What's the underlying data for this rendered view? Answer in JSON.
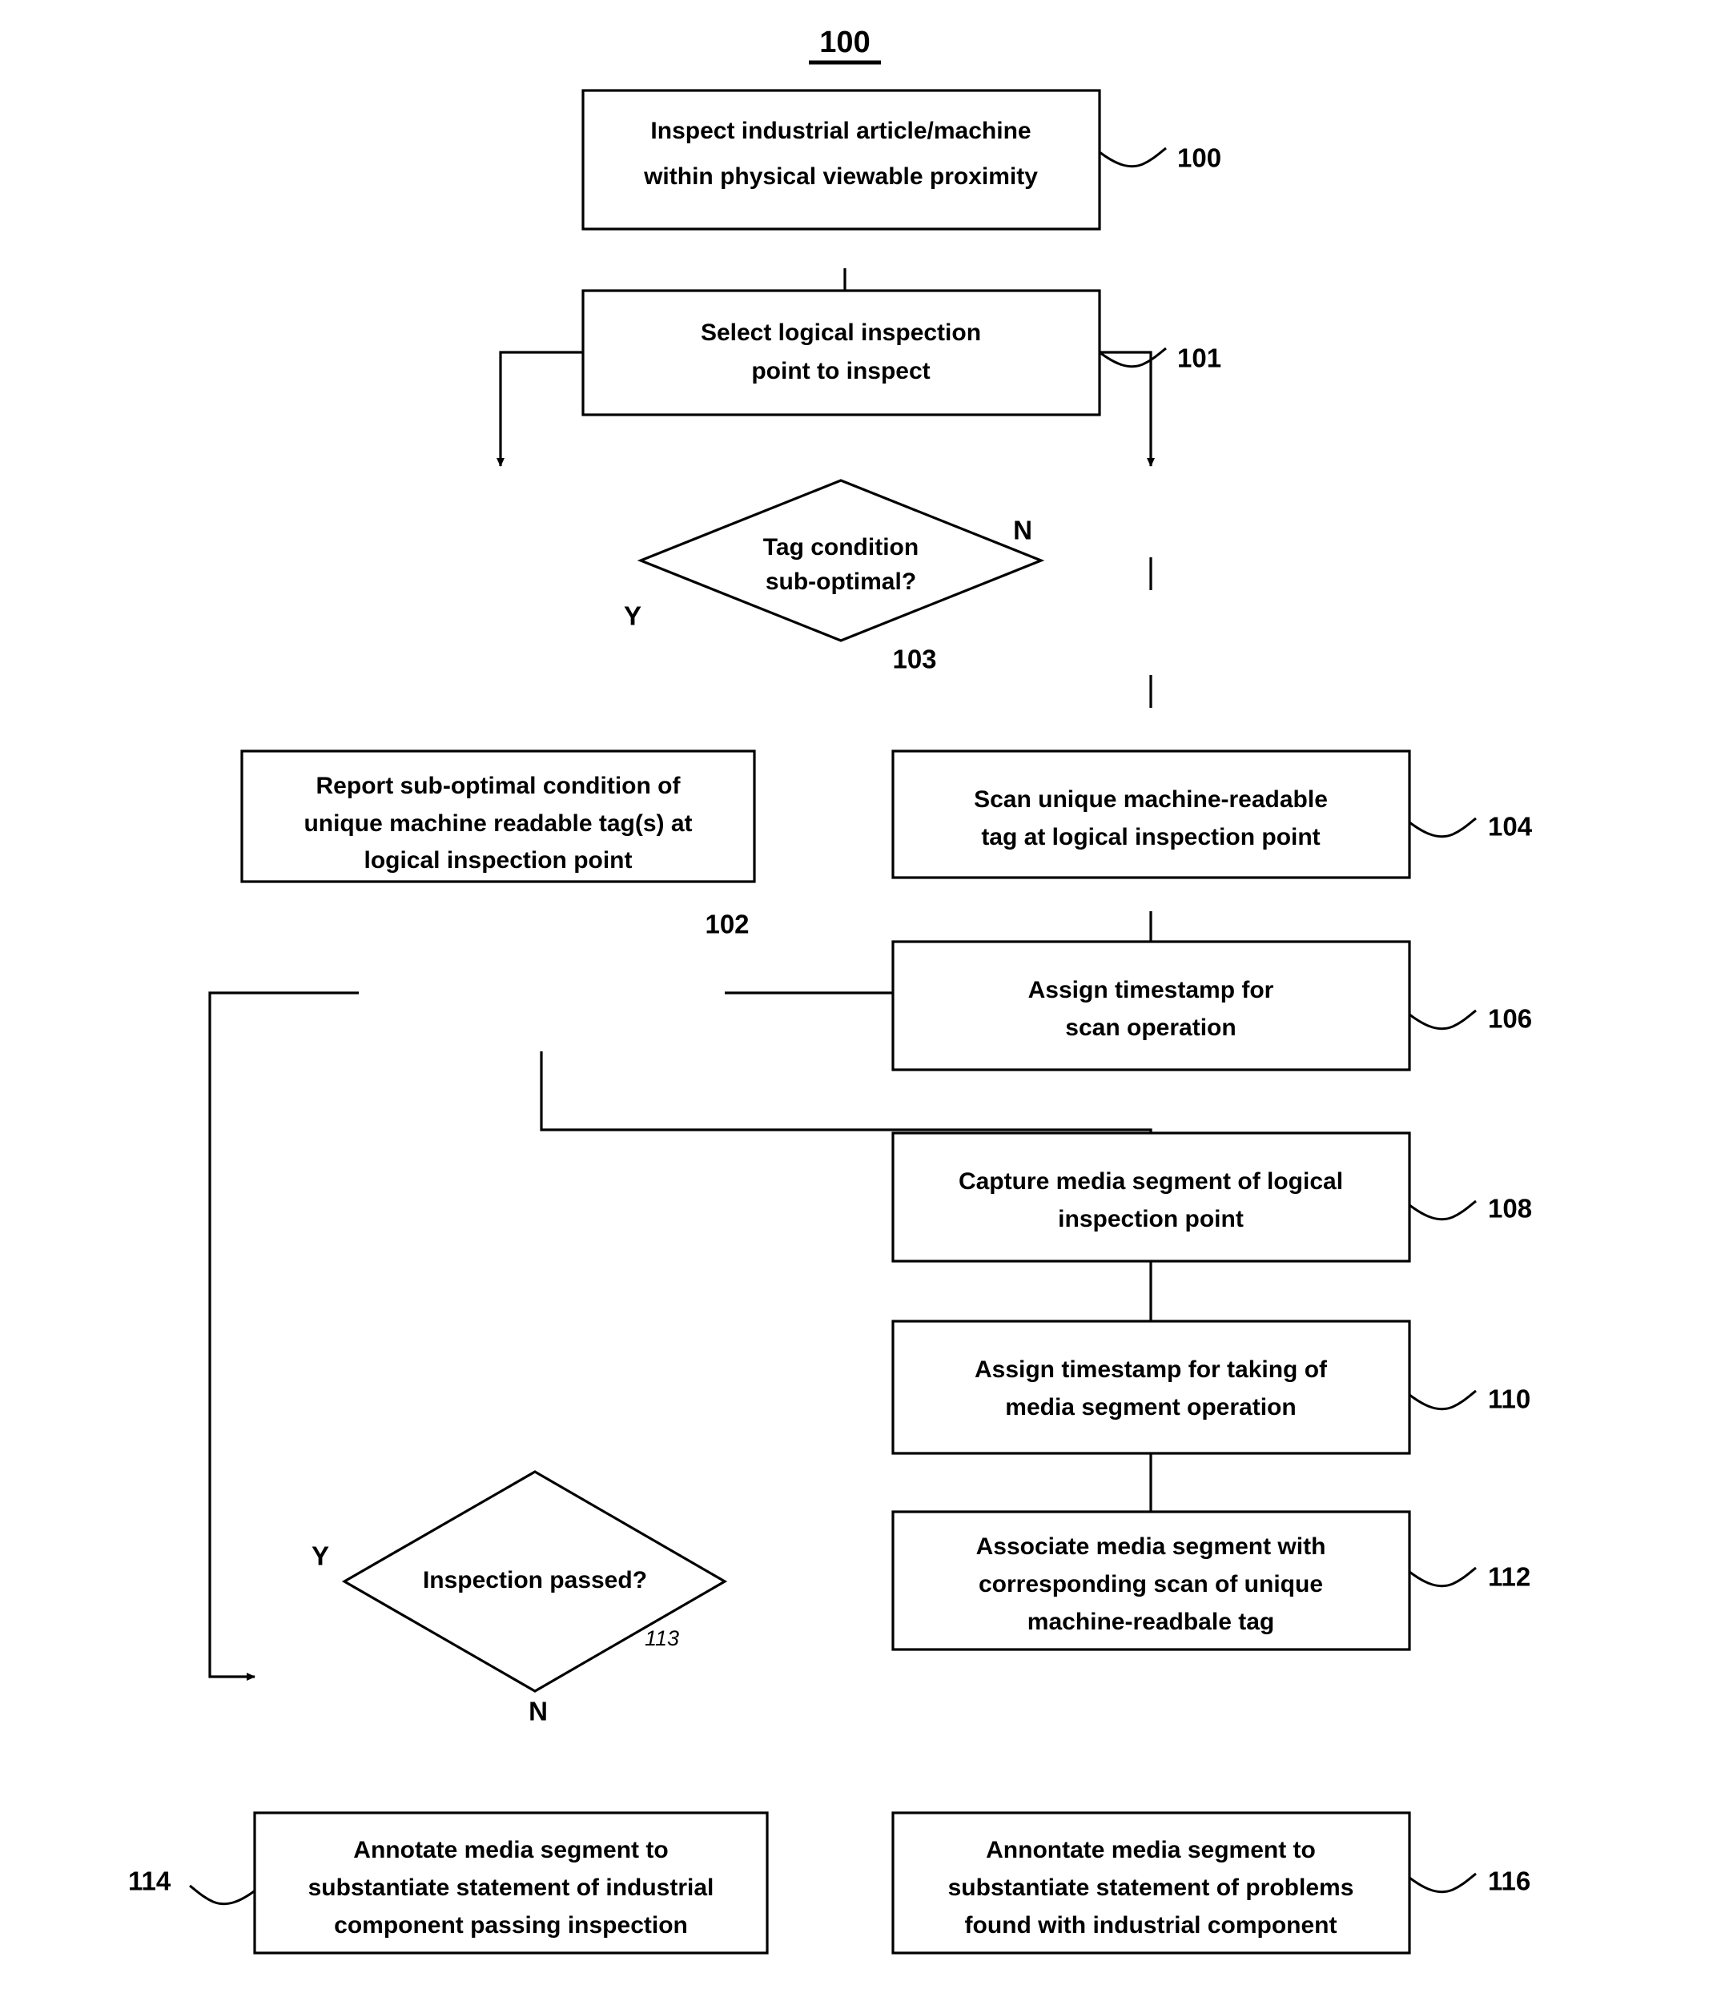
{
  "figure": {
    "title": "100"
  },
  "nodes": [
    {
      "id": "n100",
      "kind": "process",
      "ref": "100",
      "lines": [
        "Inspect industrial article/machine",
        "within physical viewable proximity"
      ]
    },
    {
      "id": "n101",
      "kind": "process",
      "ref": "101",
      "lines": [
        "Select logical inspection",
        "point to inspect"
      ]
    },
    {
      "id": "n103",
      "kind": "decision",
      "ref": "103",
      "lines": [
        "Tag condition",
        "sub-optimal?"
      ]
    },
    {
      "id": "n102",
      "kind": "process",
      "ref": "102",
      "lines": [
        "Report sub-optimal condition of",
        "unique machine readable tag(s) at",
        "logical inspection point"
      ]
    },
    {
      "id": "n104",
      "kind": "process",
      "ref": "104",
      "lines": [
        "Scan unique machine-readable",
        "tag at logical inspection point"
      ]
    },
    {
      "id": "n106",
      "kind": "process",
      "ref": "106",
      "lines": [
        "Assign timestamp for",
        "scan operation"
      ]
    },
    {
      "id": "n108",
      "kind": "process",
      "ref": "108",
      "lines": [
        "Capture media segment of logical",
        "inspection point"
      ]
    },
    {
      "id": "n110",
      "kind": "process",
      "ref": "110",
      "lines": [
        "Assign timestamp for taking of",
        "media segment operation"
      ]
    },
    {
      "id": "n112",
      "kind": "process",
      "ref": "112",
      "lines": [
        "Associate media segment with",
        "corresponding scan of unique",
        "machine-readbale tag"
      ]
    },
    {
      "id": "n113",
      "kind": "decision",
      "ref": "113",
      "lines": [
        "Inspection passed?"
      ]
    },
    {
      "id": "n114",
      "kind": "process",
      "ref": "114",
      "lines": [
        "Annotate media segment to",
        "substantiate statement of industrial",
        "component passing inspection"
      ]
    },
    {
      "id": "n116",
      "kind": "process",
      "ref": "116",
      "lines": [
        "Annontate media segment to",
        "substantiate statement of problems",
        "found with industrial component"
      ]
    }
  ],
  "branch_labels": {
    "d103_yes": "Y",
    "d103_no": "N",
    "d113_yes": "Y",
    "d113_no": "N"
  },
  "colors": {
    "stroke": "#000000",
    "fill": "#ffffff",
    "text": "#000000"
  }
}
